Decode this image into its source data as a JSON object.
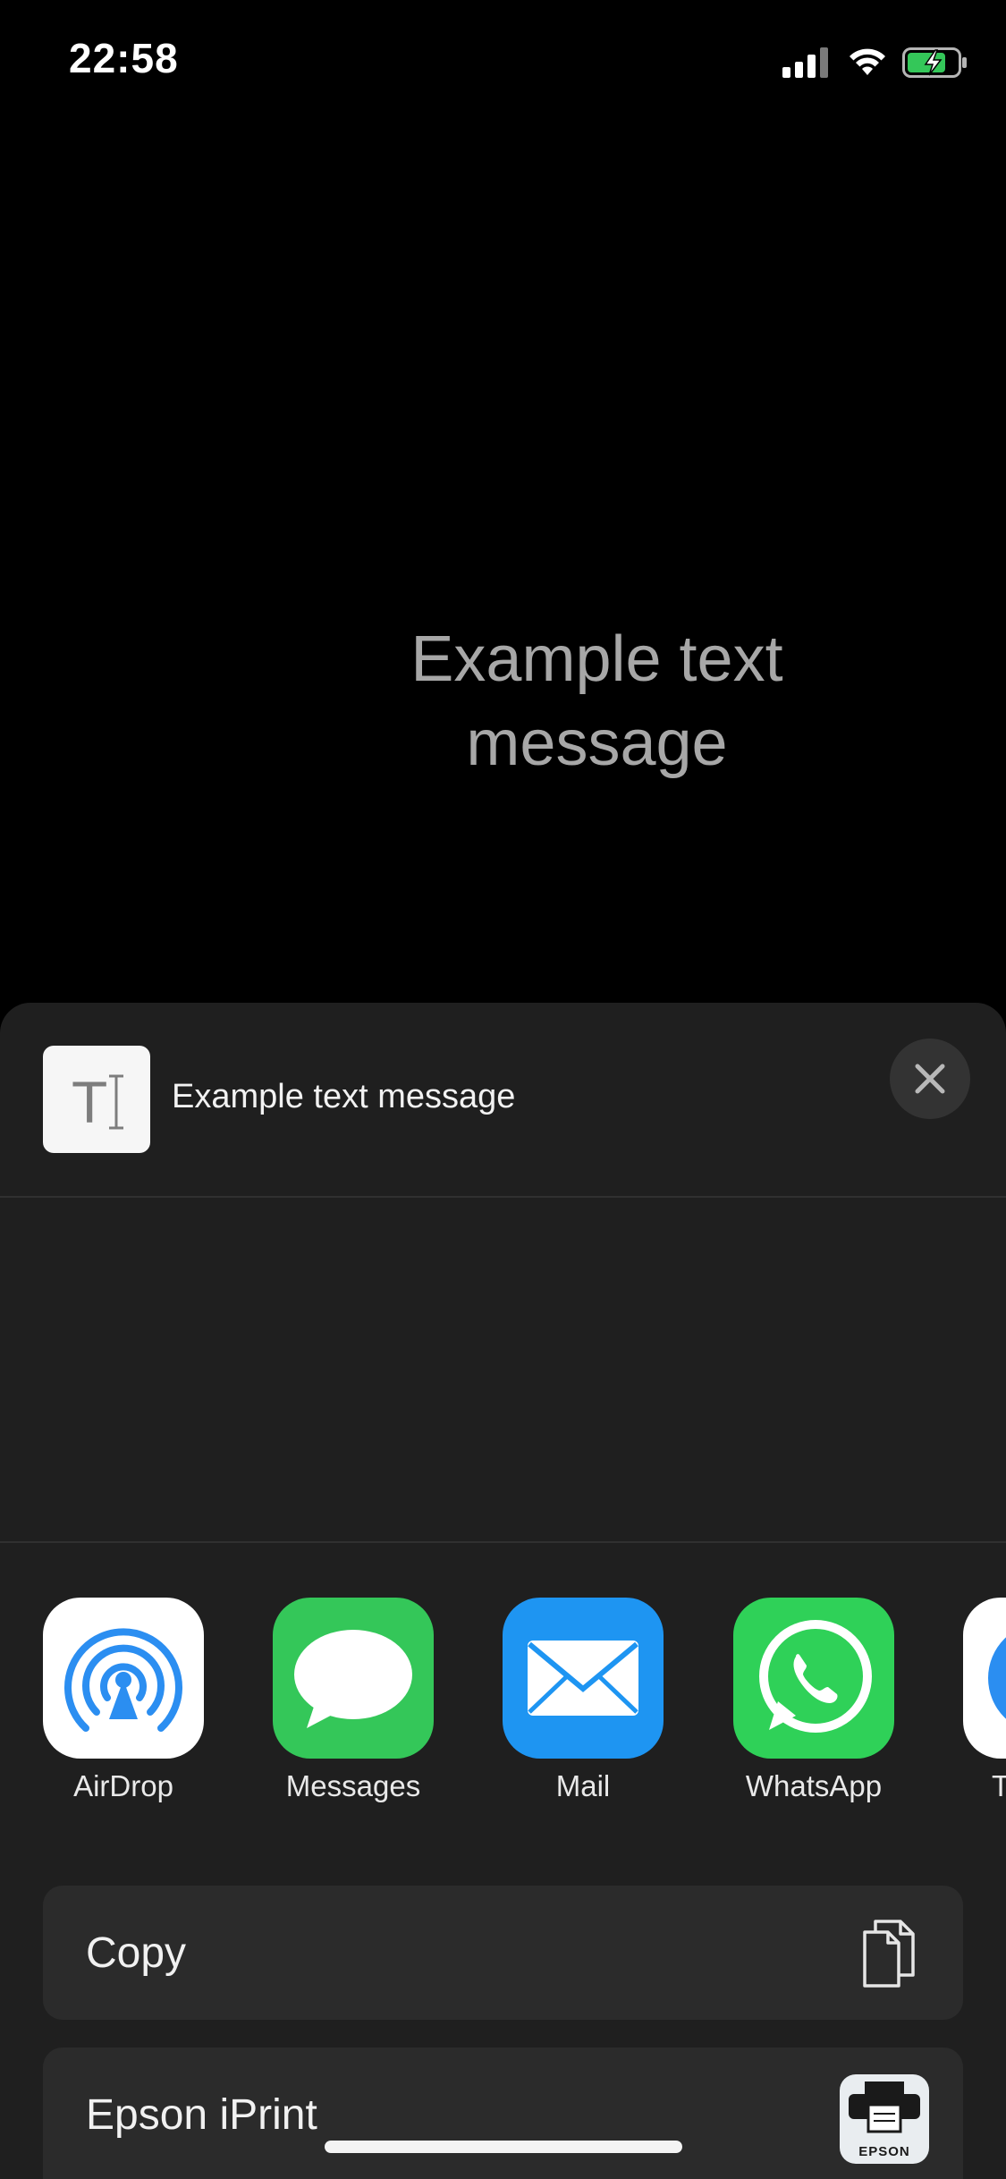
{
  "status_bar": {
    "time": "22:58",
    "icons": [
      "signal-icon",
      "wifi-icon",
      "battery-charging-icon"
    ]
  },
  "background": {
    "message": "Example text message"
  },
  "share_sheet": {
    "preview_title": "Example text message",
    "preview_icon": "text-document-icon",
    "close_icon": "close-icon",
    "apps": [
      {
        "label": "AirDrop",
        "icon": "airdrop-icon"
      },
      {
        "label": "Messages",
        "icon": "messages-icon"
      },
      {
        "label": "Mail",
        "icon": "mail-icon"
      },
      {
        "label": "WhatsApp",
        "icon": "whatsapp-icon"
      },
      {
        "label": "Te",
        "icon": "telegram-icon"
      }
    ],
    "actions": [
      {
        "label": "Copy",
        "icon": "copy-icon"
      },
      {
        "label": "Epson iPrint",
        "icon": "epson-iprint-icon",
        "icon_text": "EPSON"
      }
    ]
  },
  "colors": {
    "sheet_bg": "#1f1f1f",
    "airdrop_blue": "#2b8ef1",
    "messages_green": "#34c759",
    "mail_blue": "#1e95f2",
    "whatsapp_green": "#2fd158"
  }
}
